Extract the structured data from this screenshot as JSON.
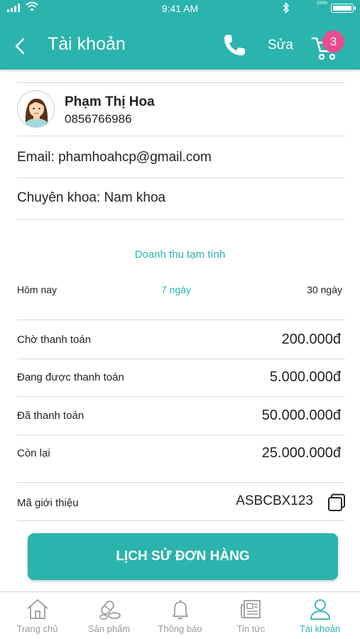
{
  "status_bar": {
    "time": "9:41 AM",
    "battery_text": "100%"
  },
  "header": {
    "title": "Tài khoản",
    "edit_label": "Sửa",
    "cart_count": "3"
  },
  "profile": {
    "name": "Phạm Thị Hoa",
    "phone": "0856766986"
  },
  "email_text": "Email: phamhoahcp@gmail.com",
  "specialty_text": "Chuyên khoa: Nam khoa",
  "revenue": {
    "title": "Doanh thu tạm tính",
    "periods": [
      "Hôm nay",
      "7 ngày",
      "30 ngày"
    ],
    "active_period": "7 ngày",
    "rows": [
      {
        "label": "Chờ thanh toán",
        "value": "200.000đ"
      },
      {
        "label": "Đang được thanh toán",
        "value": "5.000.000đ"
      },
      {
        "label": "Đã thanh toán",
        "value": "50.000.000đ"
      },
      {
        "label": "Còn lại",
        "value": "25.000.000đ"
      }
    ]
  },
  "referral": {
    "label": "Mã giới thiệu",
    "code": "ASBCBX123"
  },
  "history_button": "LỊCH SỬ ĐƠN HÀNG",
  "tabs": [
    {
      "label": "Trang chủ",
      "icon": "home-icon"
    },
    {
      "label": "Sản phẩm",
      "icon": "pills-icon"
    },
    {
      "label": "Thông báo",
      "icon": "bell-icon"
    },
    {
      "label": "Tin tức",
      "icon": "newspaper-icon"
    },
    {
      "label": "Tài khoản",
      "icon": "user-icon"
    }
  ],
  "active_tab": "Tài khoản",
  "colors": {
    "primary": "#2bb3ad",
    "badge": "#ea4c8d",
    "inactive": "#9a9a9a"
  }
}
